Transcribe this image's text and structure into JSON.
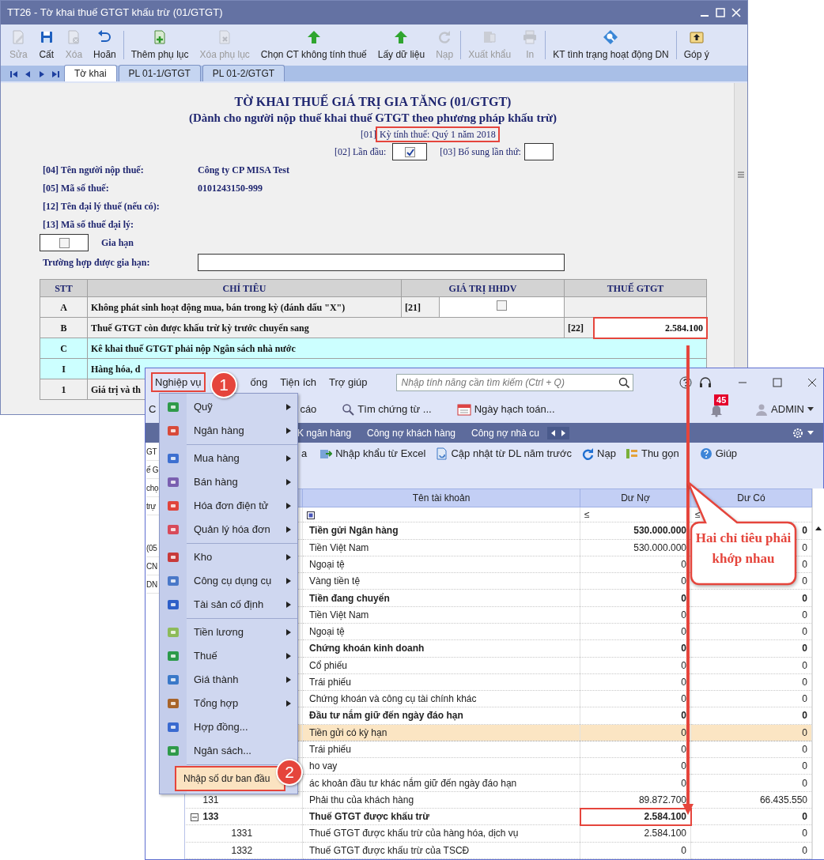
{
  "form_window": {
    "title": "TT26 - Tờ khai thuế GTGT khấu trừ (01/GTGT)",
    "toolbar": [
      [
        {
          "label": "Sửa",
          "disabled": true
        },
        {
          "label": "Cất",
          "disabled": false
        },
        {
          "label": "Xóa",
          "disabled": true
        },
        {
          "label": "Hoãn",
          "disabled": false
        }
      ],
      [
        {
          "label": "Thêm phụ lục",
          "disabled": false
        },
        {
          "label": "Xóa phụ lục",
          "disabled": true
        },
        {
          "label": "Chọn CT không tính thuế",
          "disabled": false
        },
        {
          "label": "Lấy dữ liệu",
          "disabled": false
        },
        {
          "label": "Nạp",
          "disabled": true
        }
      ],
      [
        {
          "label": "Xuất khẩu",
          "disabled": true
        },
        {
          "label": "In",
          "disabled": true
        }
      ],
      [
        {
          "label": "KT tình trạng hoạt động DN",
          "disabled": false
        }
      ],
      [
        {
          "label": "Góp ý",
          "disabled": false
        }
      ]
    ],
    "tabs": [
      {
        "label": "Tờ khai",
        "selected": true
      },
      {
        "label": "PL 01-1/GTGT",
        "selected": false
      },
      {
        "label": "PL 01-2/GTGT",
        "selected": false
      }
    ],
    "form": {
      "title": "TỜ KHAI THUẾ GIÁ TRỊ GIA TĂNG (01/GTGT)",
      "subtitle": "(Dành cho người nộp thuế khai thuế GTGT theo phương pháp khấu trừ)",
      "period_code": "[01]",
      "period": {
        "text": "Kỳ tính thuế:  Quý 1 năm 2018",
        "highlighted": true
      },
      "first_time": {
        "label": "[02] Lần đầu:",
        "checked": true
      },
      "supplement_label": "[03] Bổ sung lần thứ:",
      "info": [
        {
          "label": "[04] Tên người nộp thuế:",
          "value": "Công ty CP MISA Test"
        },
        {
          "label": "[05] Mã số thuế:",
          "value": "0101243150-999"
        },
        {
          "label": "[12] Tên đại lý thuế (nếu có):"
        },
        {
          "label": "[13] Mã số thuế đại lý:"
        }
      ],
      "extension": {
        "label": "Gia hạn",
        "checked": false
      },
      "extension_case_label": "Trường hợp được gia hạn:",
      "table": {
        "columns": [
          "STT",
          "CHỈ TIÊU",
          "GIÁ TRỊ HHDV",
          "THUẾ GTGT"
        ],
        "rows": [
          {
            "stt": "A",
            "label": "Không phát sinh hoạt động mua, bán trong kỳ (đánh dấu \"X\")",
            "kind": "checkbox",
            "code": "[21]",
            "checked": false
          },
          {
            "stt": "B",
            "label": "Thuế GTGT còn được khấu trừ kỳ trước chuyển sang",
            "kind": "value",
            "code": "[22]",
            "value": "2.584.100",
            "highlighted": true
          },
          {
            "stt": "C",
            "label": "Kê khai thuế GTGT phải nộp Ngân sách nhà nước",
            "kind": "section"
          },
          {
            "stt": "I",
            "label": "Hàng hóa, d",
            "kind": "section"
          },
          {
            "stt": "1",
            "label": "Giá trị và th",
            "kind": "plain"
          }
        ]
      }
    }
  },
  "main_window": {
    "menu": [
      {
        "label": "Nghiệp vụ",
        "highlighted": true
      },
      {
        "label": "ống",
        "highlighted": false
      },
      {
        "label": "Tiện ích",
        "highlighted": false
      },
      {
        "label": "Trợ giúp",
        "highlighted": false
      }
    ],
    "search": {
      "placeholder": "Nhập tính năng cần tìm kiếm (Ctrl + Q)"
    },
    "toolbar": [
      "C",
      "cáo",
      "Tìm chứng từ ...",
      "Ngày hạch toán..."
    ],
    "notifications": "45",
    "user": "ADMIN",
    "tabs": [
      "K ngân hàng",
      "Công nợ khách hàng",
      "Công nợ nhà cu"
    ],
    "actions": [
      "a",
      "Nhập khẩu từ Excel",
      "Cập nhật từ DL năm trước",
      "Nạp",
      "Thu gọn",
      "Giúp"
    ],
    "side_fragments": [
      "GT",
      "ế G",
      "chọ",
      "trự",
      "(05",
      "CN",
      "DN"
    ],
    "grid": {
      "columns": [
        "Tên tài khoản",
        "Dư Nợ",
        "Dư Có"
      ],
      "filters": [
        "≤",
        "≤"
      ],
      "rows": [
        {
          "name": "Tiền gửi Ngân hàng",
          "debit": "530.000.000",
          "credit": "0",
          "bold": true,
          "selected": false
        },
        {
          "name": "Tiền Việt Nam",
          "debit": "530.000.000",
          "credit": "0",
          "bold": false,
          "selected": false
        },
        {
          "name": "Ngoại tệ",
          "debit": "0",
          "credit": "0",
          "bold": false,
          "selected": false
        },
        {
          "name": "Vàng tiền tệ",
          "debit": "0",
          "credit": "0",
          "bold": false,
          "selected": false
        },
        {
          "name": "Tiền đang chuyển",
          "debit": "0",
          "credit": "0",
          "bold": true,
          "selected": false
        },
        {
          "name": "Tiền Việt Nam",
          "debit": "0",
          "credit": "0",
          "bold": false,
          "selected": false
        },
        {
          "name": "Ngoại tệ",
          "debit": "0",
          "credit": "0",
          "bold": false,
          "selected": false
        },
        {
          "name": "Chứng khoán kinh doanh",
          "debit": "0",
          "credit": "0",
          "bold": true,
          "selected": false
        },
        {
          "name": "Cổ phiếu",
          "debit": "0",
          "credit": "0",
          "bold": false,
          "selected": false
        },
        {
          "name": "Trái phiếu",
          "debit": "0",
          "credit": "0",
          "bold": false,
          "selected": false
        },
        {
          "name": "Chứng khoán và công cụ tài chính khác",
          "debit": "0",
          "credit": "0",
          "bold": false,
          "selected": false
        },
        {
          "name": "Đầu tư nắm giữ đến ngày đáo hạn",
          "debit": "0",
          "credit": "0",
          "bold": true,
          "selected": false
        },
        {
          "name": "Tiền gửi có kỳ hạn",
          "debit": "0",
          "credit": "0",
          "bold": false,
          "selected": true
        },
        {
          "name": "Trái phiếu",
          "debit": "0",
          "credit": "0",
          "bold": false,
          "selected": false
        },
        {
          "name": "ho vay",
          "debit": "0",
          "credit": "0",
          "bold": false,
          "selected": false
        },
        {
          "name": "ác khoản đầu tư khác nắm giữ đến ngày đáo hạn",
          "debit": "0",
          "credit": "0",
          "bold": false,
          "selected": false
        },
        {
          "number": "131",
          "name": "Phải thu của khách hàng",
          "debit": "89.872.700",
          "credit": "66.435.550",
          "bold": false,
          "selected": false
        },
        {
          "number": "133",
          "name": "Thuế GTGT được khấu trừ",
          "debit": "2.584.100",
          "credit": "0",
          "bold": true,
          "selected": false,
          "highlighted": true,
          "expanded": true,
          "children": [
            {
              "number": "1331",
              "name": "Thuế GTGT được khấu trừ của hàng hóa, dịch vụ",
              "debit": "2.584.100",
              "credit": "0",
              "bold": false,
              "selected": false
            },
            {
              "number": "1332",
              "name": "Thuế GTGT được khấu trừ của TSCĐ",
              "debit": "0",
              "credit": "0",
              "bold": false,
              "selected": false
            }
          ]
        }
      ]
    }
  },
  "menu_popup": {
    "groups": [
      [
        {
          "label": "Quỹ",
          "submenu": true
        },
        {
          "label": "Ngân hàng",
          "submenu": true
        }
      ],
      [
        {
          "label": "Mua hàng",
          "submenu": true
        },
        {
          "label": "Bán hàng",
          "submenu": true
        },
        {
          "label": "Hóa đơn điện tử",
          "submenu": true
        },
        {
          "label": "Quản lý hóa đơn",
          "submenu": true
        }
      ],
      [
        {
          "label": "Kho",
          "submenu": true
        },
        {
          "label": "Công cụ dụng cụ",
          "submenu": true
        },
        {
          "label": "Tài sản cố định",
          "submenu": true
        }
      ],
      [
        {
          "label": "Tiền lương",
          "submenu": true
        },
        {
          "label": "Thuế",
          "submenu": true
        },
        {
          "label": "Giá thành",
          "submenu": true
        },
        {
          "label": "Tổng hợp",
          "submenu": true
        },
        {
          "label": "Hợp đồng...",
          "submenu": false
        },
        {
          "label": "Ngân sách...",
          "submenu": false
        }
      ],
      [
        {
          "label": "Nhập số dư ban đầu",
          "submenu": false,
          "highlighted": true
        }
      ]
    ]
  },
  "annotations": {
    "steps": [
      "1",
      "2"
    ],
    "callout": "Hai chỉ tiêu phải khớp nhau"
  }
}
